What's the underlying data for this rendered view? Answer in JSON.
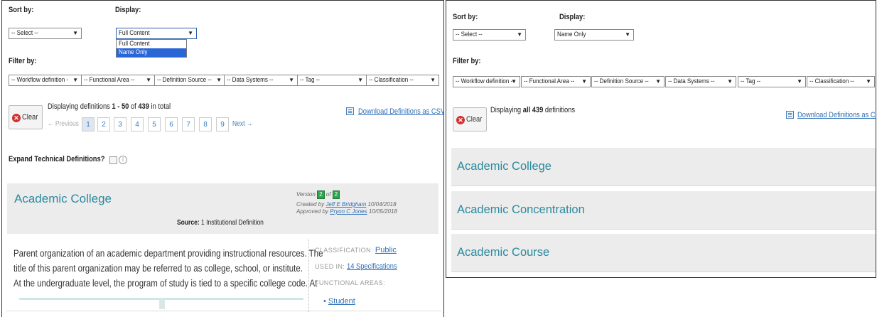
{
  "left": {
    "sort_label": "Sort by:",
    "display_label": "Display:",
    "sort_value": "-- Select --",
    "display_value": "Full Content",
    "display_options": [
      "Full Content",
      "Name Only"
    ],
    "filter_label": "Filter by:",
    "filters": [
      "-- Workflow definition - ",
      "-- Functional Area --",
      "-- Definition Source --",
      "-- Data Systems --",
      "-- Tag --",
      "-- Classification --"
    ],
    "clear_label": "Clear",
    "displaying_prefix": "Displaying definitions ",
    "displaying_range": "1 - 50",
    "displaying_of": " of ",
    "displaying_total": "439",
    "displaying_suffix": " in total",
    "prev_label": "← Previous",
    "pages": [
      "1",
      "2",
      "3",
      "4",
      "5",
      "6",
      "7",
      "8",
      "9"
    ],
    "current_page": "1",
    "next_label": "Next →",
    "download_label": "Download Definitions as CSV",
    "expand_label": "Expand Technical Definitions?",
    "info_glyph": "i",
    "card": {
      "title": "Academic College",
      "source_label": "Source:",
      "source_value": " 1 Institutional Definition",
      "version_label": "Version",
      "version_current": "2",
      "version_of": "of",
      "version_total": "2",
      "created_prefix": "Created by ",
      "created_by": "Jeff E Bridgham",
      "created_date": " 10/04/2018",
      "approved_prefix": "Approved by ",
      "approved_by": "Pryon C Jones",
      "approved_date": " 10/05/2018",
      "description_lines": [
        "Parent organization of an academic department providing instructional resources. The",
        "title of this parent organization may be referred to as college, school, or institute.",
        "At the undergraduate level, the program of study is tied to a specific college code. At"
      ],
      "classification_label": "Classification:",
      "classification_value": "Public",
      "used_in_label": "Used in:",
      "used_in_value": "14 Specifications",
      "functional_areas_label": "Functional areas:",
      "functional_area_item": "Student"
    }
  },
  "right": {
    "sort_label": "Sort by:",
    "display_label": "Display:",
    "sort_value": "-- Select --",
    "display_value": "Name Only",
    "filter_label": "Filter by:",
    "filters": [
      "-- Workflow definition - ",
      "-- Functional Area --",
      "-- Definition Source --",
      "-- Data Systems --",
      "-- Tag --",
      "-- Classification --"
    ],
    "clear_label": "Clear",
    "displaying_prefix": "Displaying ",
    "displaying_all": "all 439",
    "displaying_suffix": " definitions",
    "download_label": "Download Definitions as CSV",
    "names": [
      "Academic College",
      "Academic Concentration",
      "Academic Course"
    ]
  },
  "colors": {
    "accent": "#2a8a9e",
    "link": "#2f6fb7",
    "highlight": "#2a66d6",
    "clear_icon": "#d32f2f",
    "version_badge": "#2da44e",
    "card_bg": "#ececec"
  }
}
